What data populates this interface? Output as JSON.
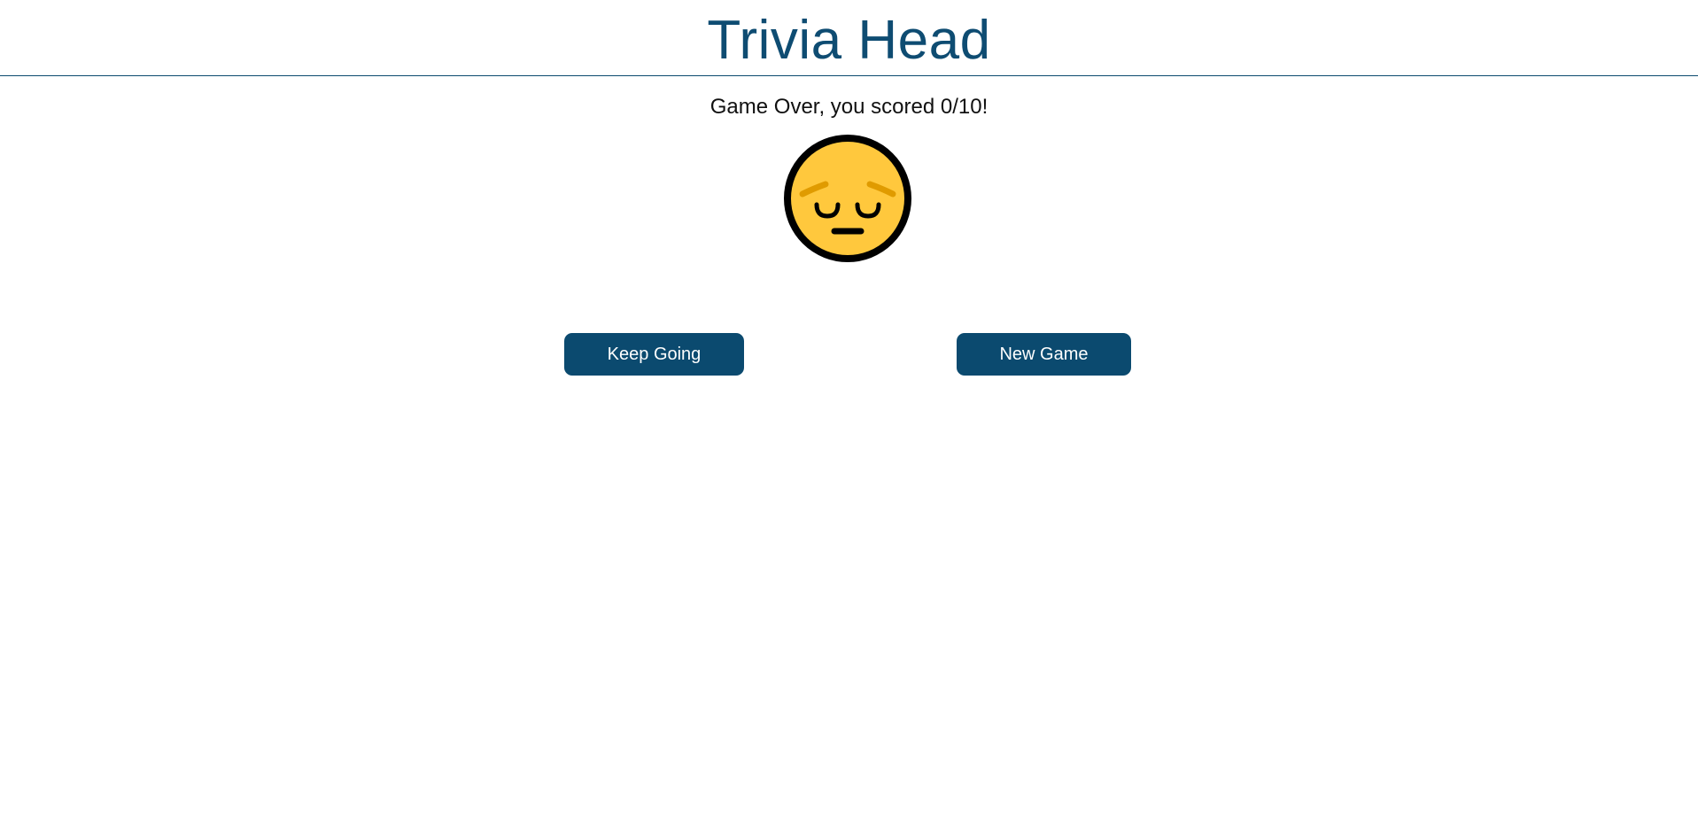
{
  "header": {
    "title": "Trivia Head"
  },
  "result": {
    "message": "Game Over, you scored 0/10!",
    "face_icon": "pensive-face-icon"
  },
  "actions": {
    "keep_going_label": "Keep Going",
    "new_game_label": "New Game"
  },
  "colors": {
    "brand": "#0b4a6f",
    "face_fill": "#ffc83d",
    "face_outline": "#000000",
    "brows": "#e09b00"
  }
}
